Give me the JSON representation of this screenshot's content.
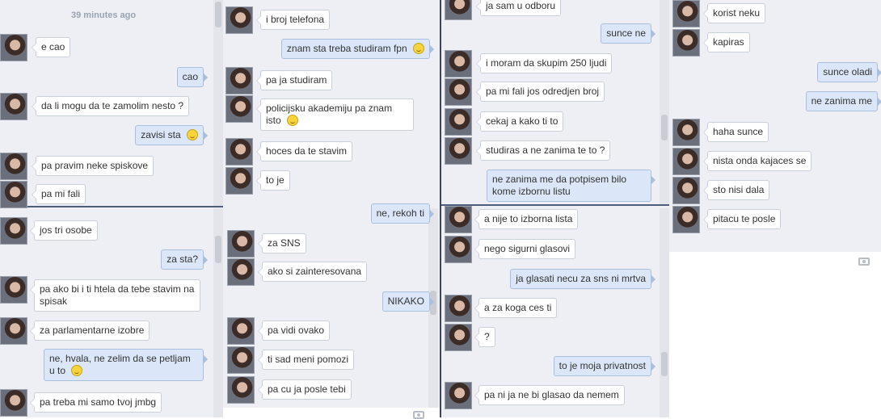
{
  "timestamp": "39 minutes ago",
  "panel1_top": [
    {
      "side": "in",
      "text": "e cao"
    },
    {
      "side": "out",
      "text": "cao"
    },
    {
      "side": "in",
      "text": "da li mogu da te zamolim nesto ?"
    },
    {
      "side": "out",
      "text": "zavisi sta"
    },
    {
      "side": "in",
      "text": "pa pravim neke spiskove"
    },
    {
      "side": "in",
      "text": "pa mi fali"
    }
  ],
  "panel1_bottom": [
    {
      "side": "in",
      "text": "jos tri osobe"
    },
    {
      "side": "out",
      "text": "za sta?"
    },
    {
      "side": "in",
      "text": "pa ako bi i ti htela da tebe stavim na spisak"
    },
    {
      "side": "in",
      "text": "za parlamentarne izobre"
    },
    {
      "side": "out",
      "text": "ne, hvala, ne zelim da se petljam u to"
    },
    {
      "side": "in",
      "text": "pa treba mi samo tvoj jmbg"
    }
  ],
  "panel2_top": [
    {
      "side": "in",
      "text": "i broj telefona"
    },
    {
      "side": "out",
      "text": "znam sta treba studiram fpn"
    },
    {
      "side": "in",
      "text": "pa ja studiram"
    },
    {
      "side": "in",
      "text": "policijsku akademiju pa znam isto"
    },
    {
      "side": "in",
      "text": "hoces da te stavim"
    },
    {
      "side": "in",
      "text": "to je"
    },
    {
      "side": "out",
      "text": "ne, rekoh ti"
    }
  ],
  "panel2_bottom": [
    {
      "side": "in",
      "text": "za SNS"
    },
    {
      "side": "in",
      "text": "ako si zainteresovana"
    },
    {
      "side": "out",
      "text": "NIKAKO"
    },
    {
      "side": "in",
      "text": "pa vidi ovako"
    },
    {
      "side": "in",
      "text": "ti sad meni pomozi"
    },
    {
      "side": "in",
      "text": "pa cu ja posle tebi"
    }
  ],
  "panel3_top": [
    {
      "side": "in",
      "text": "ja sam u odboru"
    },
    {
      "side": "out",
      "text": "sunce ne"
    },
    {
      "side": "in",
      "text": "i moram da skupim 250 ljudi"
    },
    {
      "side": "in",
      "text": "pa mi fali jos odredjen broj"
    },
    {
      "side": "in",
      "text": "cekaj a kako ti to"
    },
    {
      "side": "in",
      "text": "studiras a ne zanima te to ?"
    },
    {
      "side": "out",
      "text": "ne zanima me da potpisem bilo kome izbornu listu"
    }
  ],
  "panel3_bottom": [
    {
      "side": "in",
      "text": "a nije to izborna lista"
    },
    {
      "side": "in",
      "text": "nego sigurni glasovi"
    },
    {
      "side": "out",
      "text": "ja glasati necu za sns ni mrtva"
    },
    {
      "side": "in",
      "text": "a za koga ces ti"
    },
    {
      "side": "in",
      "text": "?"
    },
    {
      "side": "out",
      "text": "to je moja privatnost"
    },
    {
      "side": "in",
      "text": "pa ni ja ne bi glasao da nemem"
    }
  ],
  "panel4": [
    {
      "side": "in",
      "text": "korist neku"
    },
    {
      "side": "in",
      "text": "kapiras"
    },
    {
      "side": "out",
      "text": "sunce oladi"
    },
    {
      "side": "out",
      "text": "ne zanima me"
    },
    {
      "side": "in",
      "text": "haha sunce"
    },
    {
      "side": "in",
      "text": "nista onda kajaces se"
    },
    {
      "side": "in",
      "text": "sto nisi dala"
    },
    {
      "side": "in",
      "text": "pitacu te posle"
    }
  ],
  "icons": {
    "camera": "camera-icon",
    "smiley": "smiley-icon",
    "avatar": "avatar"
  },
  "colors": {
    "panel_bg": "#edeff4",
    "outgoing_bubble": "#dbe7f8",
    "incoming_bubble": "#ffffff",
    "divider": "#4d5d7a"
  }
}
